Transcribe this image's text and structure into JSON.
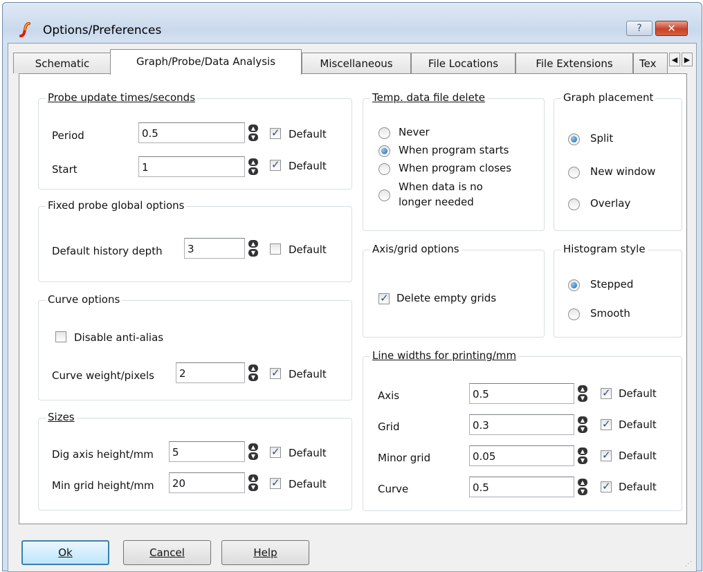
{
  "window": {
    "title": "Options/Preferences",
    "help_btn": "?",
    "close_btn": "✕"
  },
  "tabs": [
    "Schematic",
    "Graph/Probe/Data Analysis",
    "Miscellaneous",
    "File Locations",
    "File Extensions",
    "Tex"
  ],
  "active_tab": "Graph/Probe/Data Analysis",
  "probe_update": {
    "title": "Probe update times/seconds",
    "period_label": "Period",
    "period_value": "0.5",
    "start_label": "Start",
    "start_value": "1",
    "default_label": "Default"
  },
  "fixed_probe": {
    "title": "Fixed probe global options",
    "history_label": "Default history depth",
    "history_value": "3",
    "default_label": "Default"
  },
  "curve_options": {
    "title": "Curve options",
    "antialias_label": "Disable anti-alias",
    "weight_label": "Curve weight/pixels",
    "weight_value": "2",
    "default_label": "Default"
  },
  "sizes": {
    "title": "Sizes",
    "dig_axis_label": "Dig axis height/mm",
    "dig_axis_value": "5",
    "min_grid_label": "Min grid height/mm",
    "min_grid_value": "20",
    "default_label": "Default"
  },
  "temp_delete": {
    "title": "Temp. data file delete",
    "options": [
      "Never",
      "When program starts",
      "When program closes",
      "When data is no",
      "longer needed"
    ],
    "selected": "When program starts"
  },
  "graph_placement": {
    "title": "Graph placement",
    "options": [
      "Split",
      "New window",
      "Overlay"
    ],
    "selected": "Split"
  },
  "axis_grid": {
    "title": "Axis/grid options",
    "delete_empty_label": "Delete empty grids"
  },
  "histogram": {
    "title": "Histogram style",
    "options": [
      "Stepped",
      "Smooth"
    ],
    "selected": "Stepped"
  },
  "line_widths": {
    "title": "Line widths for printing/mm",
    "axis_label": "Axis",
    "axis_value": "0.5",
    "grid_label": "Grid",
    "grid_value": "0.3",
    "minor_label": "Minor grid",
    "minor_value": "0.05",
    "curve_label": "Curve",
    "curve_value": "0.5",
    "default_label": "Default"
  },
  "buttons": {
    "ok": "Ok",
    "cancel": "Cancel",
    "help": "Help"
  }
}
